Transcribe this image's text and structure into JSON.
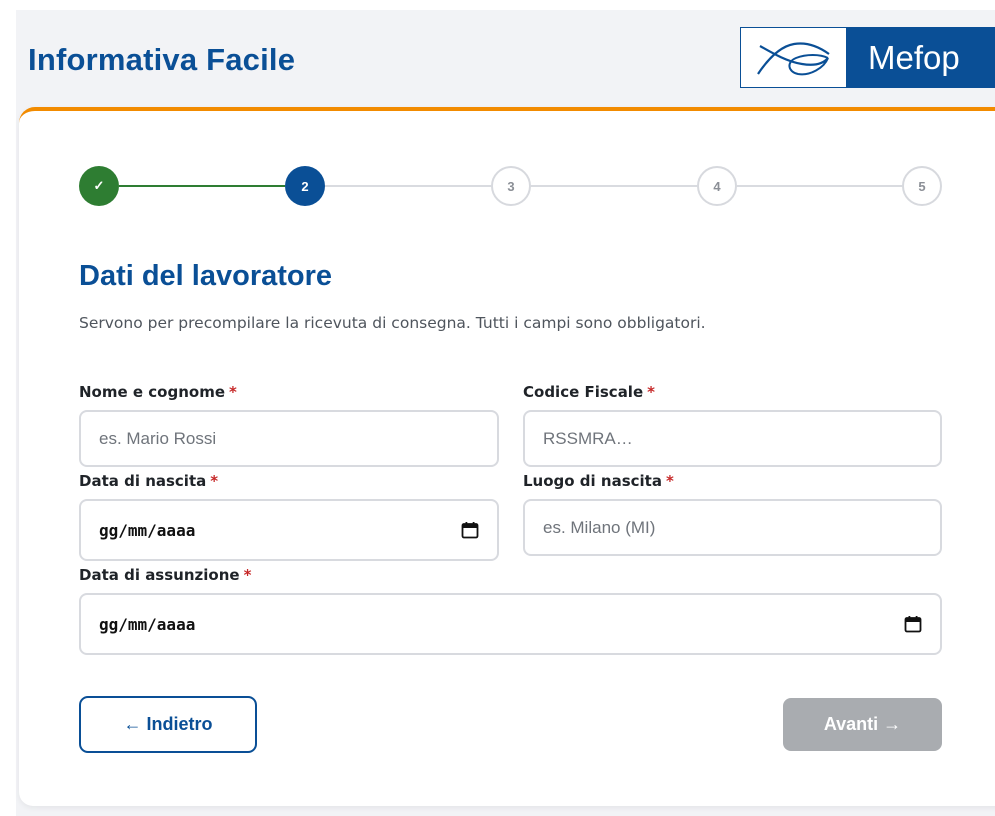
{
  "header": {
    "title": "Informativa Facile",
    "logo_text": "Mefop"
  },
  "stepper": {
    "steps": [
      {
        "label": "✓",
        "state": "complete"
      },
      {
        "label": "2",
        "state": "current"
      },
      {
        "label": "3",
        "state": "pending"
      },
      {
        "label": "4",
        "state": "pending"
      },
      {
        "label": "5",
        "state": "pending"
      }
    ]
  },
  "section": {
    "title": "Dati del lavoratore",
    "description": "Servono per precompilare la ricevuta di consegna. Tutti i campi sono obbligatori."
  },
  "form": {
    "required_marker": "*",
    "name": {
      "label": "Nome e cognome",
      "placeholder": "es. Mario Rossi"
    },
    "fiscal_code": {
      "label": "Codice Fiscale",
      "placeholder": "RSSMRA…"
    },
    "birth_date": {
      "label": "Data di nascita",
      "value": "gg/mm/aaaa"
    },
    "birth_place": {
      "label": "Luogo di nascita",
      "placeholder": "es. Milano (MI)"
    },
    "hire_date": {
      "label": "Data di assunzione",
      "value": "gg/mm/aaaa"
    }
  },
  "actions": {
    "back_label": "← Indietro",
    "next_label": "Avanti →"
  },
  "colors": {
    "brand_blue": "#0a4f96",
    "accent_orange": "#f28b00",
    "success_green": "#2e7d32",
    "required_red": "#c62828",
    "disabled_gray": "#a9acb0"
  },
  "icons": {
    "logo_mark": "mefop-logo-mark",
    "date_picker": "calendar-icon"
  }
}
